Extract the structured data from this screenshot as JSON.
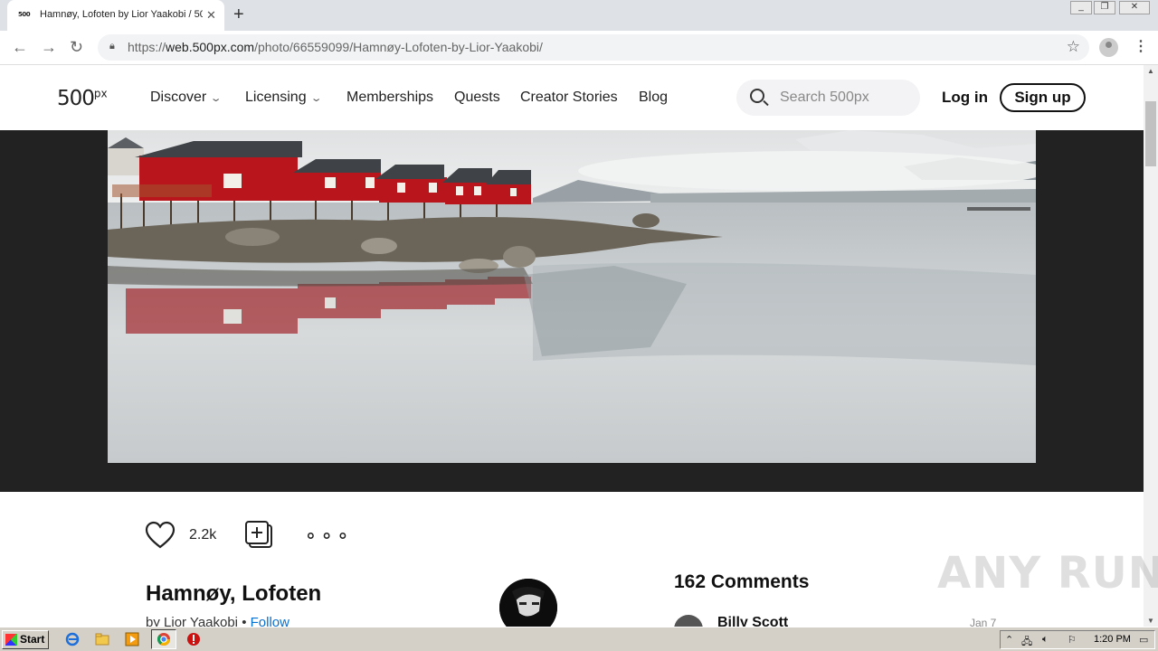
{
  "browser": {
    "tab_title": "Hamnøy, Lofoten by Lior Yaakobi / 500px",
    "favicon_text": "500",
    "url_scheme": "https://",
    "url_host": "web.500px.com",
    "url_path": "/photo/66559099/Hamnøy-Lofoten-by-Lior-Yaakobi/"
  },
  "header": {
    "logo": "500",
    "logo_sup": "px",
    "nav": {
      "discover": "Discover",
      "licensing": "Licensing",
      "memberships": "Memberships",
      "quests": "Quests",
      "creator_stories": "Creator Stories",
      "blog": "Blog"
    },
    "search_placeholder": "Search 500px",
    "login": "Log in",
    "signup": "Sign up"
  },
  "photo": {
    "likes": "2.2k",
    "title": "Hamnøy, Lofoten",
    "by_prefix": "by",
    "author": "Lior Yaakobi",
    "separator": "•",
    "follow": "Follow"
  },
  "comments": {
    "title": "162 Comments",
    "first": {
      "name": "Billy Scott",
      "date": "Jan 7"
    }
  },
  "watermark": "ANY RUN",
  "taskbar": {
    "start": "Start",
    "clock": "1:20 PM"
  },
  "colors": {
    "accent_link": "#0870d1",
    "stage_bg": "#222222",
    "cabin_red": "#b8161c"
  }
}
